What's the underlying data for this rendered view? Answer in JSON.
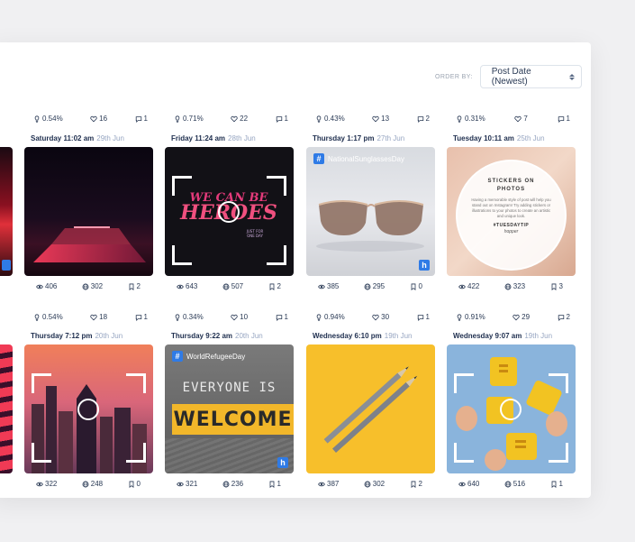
{
  "toolbar": {
    "order_label": "ORDER BY:",
    "order_value": "Post Date (Newest)"
  },
  "rows": [
    {
      "cards": [
        {
          "engagement": "0.54%",
          "likes": "16",
          "comments": "1",
          "day": "Saturday 11:02 am",
          "date": "29th Jun",
          "hashtag": "",
          "views": "406",
          "reach": "302",
          "saves": "2"
        },
        {
          "engagement": "0.71%",
          "likes": "22",
          "comments": "1",
          "day": "Friday 11:24 am",
          "date": "28th Jun",
          "hashtag": "",
          "views": "643",
          "reach": "507",
          "saves": "2"
        },
        {
          "engagement": "0.43%",
          "likes": "13",
          "comments": "2",
          "day": "Thursday 1:17 pm",
          "date": "27th Jun",
          "hashtag": "NationalSunglassesDay",
          "views": "385",
          "reach": "295",
          "saves": "0"
        },
        {
          "engagement": "0.31%",
          "likes": "7",
          "comments": "1",
          "day": "Tuesday 10:11 am",
          "date": "25th Jun",
          "hashtag": "",
          "views": "422",
          "reach": "323",
          "saves": "3"
        }
      ]
    },
    {
      "cards": [
        {
          "engagement": "0.54%",
          "likes": "18",
          "comments": "1",
          "day": "Thursday 7:12 pm",
          "date": "20th Jun",
          "hashtag": "",
          "views": "322",
          "reach": "248",
          "saves": "0"
        },
        {
          "engagement": "0.34%",
          "likes": "10",
          "comments": "1",
          "day": "Thursday 9:22 am",
          "date": "20th Jun",
          "hashtag": "WorldRefugeeDay",
          "views": "321",
          "reach": "236",
          "saves": "1"
        },
        {
          "engagement": "0.94%",
          "likes": "30",
          "comments": "1",
          "day": "Wednesday 6:10 pm",
          "date": "19th Jun",
          "hashtag": "",
          "views": "387",
          "reach": "302",
          "saves": "2"
        },
        {
          "engagement": "0.91%",
          "likes": "29",
          "comments": "2",
          "day": "Wednesday 9:07 am",
          "date": "19th Jun",
          "hashtag": "",
          "views": "640",
          "reach": "516",
          "saves": "1"
        }
      ]
    }
  ],
  "post_text": {
    "hearts_title": "WE CAN BE HEROES",
    "hearts_subtitle": "JUST FOR ONE DAY",
    "tip_title": "STICKERS ON PHOTOS",
    "tip_body": "Having a memorable style of post will help you stand out on Instagram! Try adding stickers or illustrations to your photos to create an artistic and unique look.",
    "tip_tag": "#TUESDAYTIP",
    "tip_brand": "hopper",
    "sign_top": "EVERYONE IS",
    "sign_main": "WELCOME"
  },
  "colors": {
    "accent": "#2f7be6",
    "text_dark": "#1e2e4e",
    "text_muted": "#97a6c2"
  }
}
